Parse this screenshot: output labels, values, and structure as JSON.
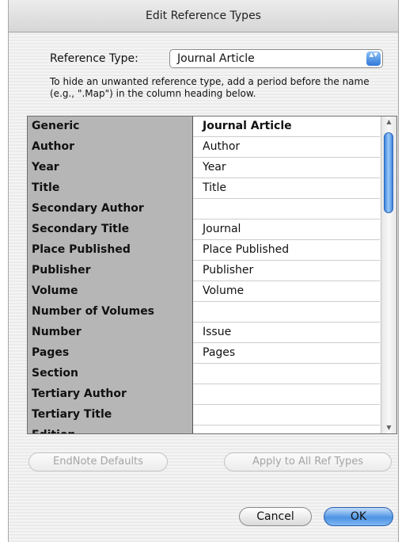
{
  "window": {
    "title": "Edit Reference Types"
  },
  "reftype": {
    "label": "Reference Type:",
    "selected": "Journal Article",
    "arrows": "▲▼"
  },
  "hint": "To hide an unwanted reference type, add a period before the name (e.g., \".Map\") in the column heading below.",
  "table": {
    "rows": [
      {
        "field": "Generic",
        "value": "Journal Article"
      },
      {
        "field": "Author",
        "value": "Author"
      },
      {
        "field": "Year",
        "value": "Year"
      },
      {
        "field": "Title",
        "value": "Title"
      },
      {
        "field": "Secondary Author",
        "value": ""
      },
      {
        "field": "Secondary Title",
        "value": "Journal"
      },
      {
        "field": "Place Published",
        "value": "Place Published"
      },
      {
        "field": "Publisher",
        "value": "Publisher"
      },
      {
        "field": "Volume",
        "value": "Volume"
      },
      {
        "field": "Number of Volumes",
        "value": ""
      },
      {
        "field": "Number",
        "value": "Issue"
      },
      {
        "field": "Pages",
        "value": "Pages"
      },
      {
        "field": "Section",
        "value": ""
      },
      {
        "field": "Tertiary Author",
        "value": ""
      },
      {
        "field": "Tertiary Title",
        "value": ""
      },
      {
        "field": "Edition",
        "value": ""
      }
    ],
    "scroll_up": "▲",
    "scroll_down": "▼"
  },
  "buttons": {
    "endnote_defaults": "EndNote Defaults",
    "apply_all": "Apply to All Ref Types",
    "cancel": "Cancel",
    "ok": "OK"
  },
  "colors": {
    "accent": "#4e93e3",
    "field_column": "#b6b6b6"
  }
}
